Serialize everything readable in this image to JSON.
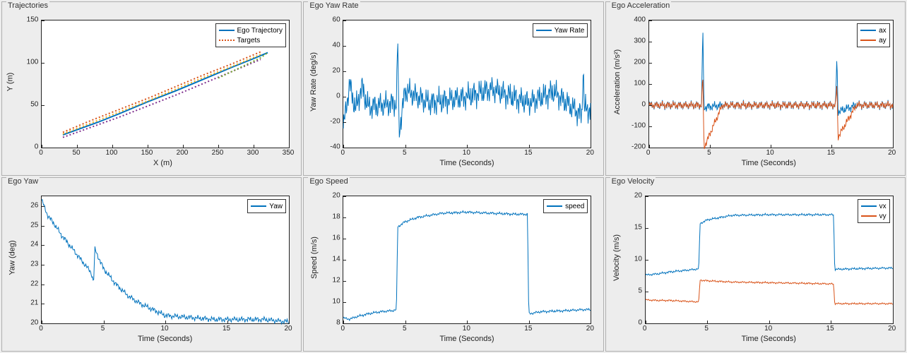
{
  "panels": {
    "trajectories": {
      "title": "Trajectories",
      "xlabel": "X (m)",
      "ylabel": "Y (m)",
      "legend": [
        "Ego Trajectory",
        "Targets"
      ]
    },
    "yaw_rate": {
      "title": "Ego Yaw Rate",
      "xlabel": "Time (Seconds)",
      "ylabel": "Yaw Rate (deg/s)",
      "legend": [
        "Yaw Rate"
      ]
    },
    "accel": {
      "title": "Ego Acceleration",
      "xlabel": "Time (Seconds)",
      "ylabel": "Acceleration (m/s²)",
      "legend": [
        "ax",
        "ay"
      ]
    },
    "yaw": {
      "title": "Ego Yaw",
      "xlabel": "Time (Seconds)",
      "ylabel": "Yaw (deg)",
      "legend": [
        "Yaw"
      ]
    },
    "speed": {
      "title": "Ego Speed",
      "xlabel": "Time (Seconds)",
      "ylabel": "Speed (m/s)",
      "legend": [
        "speed"
      ]
    },
    "velocity": {
      "title": "Ego Velocity",
      "xlabel": "Time (Seconds)",
      "ylabel": "Velocity (m/s)",
      "legend": [
        "vx",
        "vy"
      ]
    }
  },
  "ticks": {
    "trajectories_x": [
      "0",
      "50",
      "100",
      "150",
      "200",
      "250",
      "300",
      "350"
    ],
    "trajectories_y": [
      "0",
      "50",
      "100",
      "150"
    ],
    "yaw_rate_x": [
      "0",
      "5",
      "10",
      "15",
      "20"
    ],
    "yaw_rate_y": [
      "-40",
      "-20",
      "0",
      "20",
      "40",
      "60"
    ],
    "accel_x": [
      "0",
      "5",
      "10",
      "15",
      "20"
    ],
    "accel_y": [
      "-200",
      "-100",
      "0",
      "100",
      "200",
      "300",
      "400"
    ],
    "yaw_x": [
      "0",
      "5",
      "10",
      "15",
      "20"
    ],
    "yaw_y": [
      "20",
      "21",
      "22",
      "23",
      "24",
      "25",
      "26"
    ],
    "speed_x": [
      "0",
      "5",
      "10",
      "15",
      "20"
    ],
    "speed_y": [
      "8",
      "10",
      "12",
      "14",
      "16",
      "18",
      "20"
    ],
    "velocity_x": [
      "0",
      "5",
      "10",
      "15",
      "20"
    ],
    "velocity_y": [
      "0",
      "5",
      "10",
      "15",
      "20"
    ]
  },
  "colors": {
    "blue": "#0072bd",
    "orange": "#d95319",
    "yellow": "#edb120",
    "purple": "#7e2f8e",
    "green": "#77ac30"
  },
  "chart_data": [
    {
      "type": "line",
      "title": "Trajectories",
      "xlabel": "X (m)",
      "ylabel": "Y (m)",
      "xlim": [
        0,
        350
      ],
      "ylim": [
        0,
        150
      ],
      "series": [
        {
          "name": "Ego Trajectory",
          "style": "solid",
          "color": "#0072bd",
          "x": [
            30,
            50,
            80,
            110,
            150,
            190,
            230,
            270,
            300,
            320
          ],
          "y": [
            15,
            21,
            30,
            40,
            54,
            67,
            81,
            95,
            105,
            112
          ]
        },
        {
          "name": "Targets",
          "style": "dotted",
          "color": "#d95319",
          "x": [
            30,
            70,
            110,
            150,
            190,
            230,
            270,
            310
          ],
          "y": [
            18,
            32,
            45,
            58,
            72,
            86,
            99,
            113
          ]
        },
        {
          "name": "Targets",
          "style": "dotted",
          "color": "#edb120",
          "x": [
            30,
            70,
            110,
            150,
            190,
            230,
            270,
            310
          ],
          "y": [
            16,
            29,
            42,
            55,
            69,
            83,
            96,
            110
          ]
        },
        {
          "name": "Targets",
          "style": "dotted",
          "color": "#7e2f8e",
          "x": [
            30,
            70,
            110,
            150,
            190,
            230,
            270,
            310
          ],
          "y": [
            12,
            24,
            36,
            49,
            62,
            76,
            90,
            104
          ]
        },
        {
          "name": "Targets",
          "style": "dotted",
          "color": "#77ac30",
          "x": [
            250,
            270,
            290,
            310,
            320
          ],
          "y": [
            82,
            90,
            98,
            106,
            112
          ]
        }
      ]
    },
    {
      "type": "line",
      "title": "Ego Yaw Rate",
      "xlabel": "Time (Seconds)",
      "ylabel": "Yaw Rate (deg/s)",
      "xlim": [
        0,
        20
      ],
      "ylim": [
        -40,
        60
      ],
      "series": [
        {
          "name": "Yaw Rate",
          "color": "#0072bd",
          "note": "noisy oscillation about zero",
          "x": [
            0,
            0.5,
            1,
            1.5,
            2,
            4.3,
            4.4,
            4.5,
            5,
            7,
            10,
            12,
            15,
            17,
            19.3,
            19.4,
            19.5
          ],
          "y": [
            -25,
            10,
            -10,
            8,
            -8,
            -5,
            48,
            -28,
            5,
            -5,
            0,
            6,
            -5,
            4,
            -15,
            25,
            -10
          ]
        }
      ]
    },
    {
      "type": "line",
      "title": "Ego Acceleration",
      "xlabel": "Time (Seconds)",
      "ylabel": "Acceleration (m/s²)",
      "xlim": [
        0,
        20
      ],
      "ylim": [
        -200,
        400
      ],
      "series": [
        {
          "name": "ax",
          "color": "#0072bd",
          "x": [
            0,
            2,
            4.3,
            4.4,
            4.5,
            6,
            10,
            14.9,
            15.3,
            15.4,
            15.5,
            17,
            20
          ],
          "y": [
            0,
            0,
            0,
            375,
            -10,
            0,
            0,
            0,
            0,
            230,
            -30,
            0,
            0
          ]
        },
        {
          "name": "ay",
          "color": "#d95319",
          "x": [
            0,
            2,
            4.3,
            4.4,
            4.5,
            6,
            10,
            14.9,
            15.3,
            15.4,
            15.5,
            17,
            20
          ],
          "y": [
            0,
            0,
            0,
            150,
            -200,
            0,
            0,
            0,
            0,
            100,
            -150,
            0,
            0
          ]
        }
      ]
    },
    {
      "type": "line",
      "title": "Ego Yaw",
      "xlabel": "Time (Seconds)",
      "ylabel": "Yaw (deg)",
      "xlim": [
        0,
        20
      ],
      "ylim": [
        20,
        26.5
      ],
      "series": [
        {
          "name": "Yaw",
          "color": "#0072bd",
          "x": [
            0,
            0.5,
            1,
            1.5,
            2,
            3,
            4,
            4.2,
            4.3,
            5,
            6,
            7,
            8,
            9,
            10,
            12,
            14,
            16,
            18,
            19.5
          ],
          "y": [
            26.3,
            25.5,
            25.1,
            24.6,
            24.2,
            23.4,
            22.6,
            22.1,
            23.8,
            22.8,
            22.0,
            21.4,
            21.0,
            20.7,
            20.4,
            20.3,
            20.2,
            20.2,
            20.2,
            20.1
          ]
        }
      ]
    },
    {
      "type": "line",
      "title": "Ego Speed",
      "xlabel": "Time (Seconds)",
      "ylabel": "Speed (m/s)",
      "xlim": [
        0,
        20
      ],
      "ylim": [
        8,
        20
      ],
      "series": [
        {
          "name": "speed",
          "color": "#0072bd",
          "x": [
            0,
            0.5,
            1,
            2,
            3,
            4,
            4.3,
            4.4,
            5,
            6,
            7,
            8,
            10,
            12,
            14,
            14.9,
            15.0,
            16,
            18,
            19.5
          ],
          "y": [
            8.5,
            8.4,
            8.6,
            8.9,
            9.1,
            9.2,
            9.3,
            17.1,
            17.6,
            18.0,
            18.2,
            18.4,
            18.5,
            18.4,
            18.3,
            18.3,
            8.9,
            9.1,
            9.2,
            9.3
          ]
        }
      ]
    },
    {
      "type": "line",
      "title": "Ego Velocity",
      "xlabel": "Time (Seconds)",
      "ylabel": "Velocity (m/s)",
      "xlim": [
        0,
        20
      ],
      "ylim": [
        0,
        20
      ],
      "series": [
        {
          "name": "vx",
          "color": "#0072bd",
          "x": [
            0,
            1,
            2,
            3,
            4,
            4.3,
            4.4,
            5,
            7,
            10,
            13,
            15.2,
            15.3,
            17,
            19.5
          ],
          "y": [
            7.6,
            7.8,
            8.1,
            8.3,
            8.5,
            8.6,
            15.7,
            16.3,
            17.0,
            17.1,
            17.1,
            17.1,
            8.5,
            8.6,
            8.7
          ]
        },
        {
          "name": "vy",
          "color": "#d95319",
          "x": [
            0,
            1,
            2,
            3,
            4,
            4.3,
            4.4,
            5,
            7,
            10,
            13,
            15.2,
            15.3,
            17,
            19.5
          ],
          "y": [
            3.7,
            3.6,
            3.6,
            3.5,
            3.4,
            3.4,
            6.8,
            6.7,
            6.5,
            6.4,
            6.3,
            6.2,
            3.1,
            3.1,
            3.1
          ]
        }
      ]
    }
  ]
}
